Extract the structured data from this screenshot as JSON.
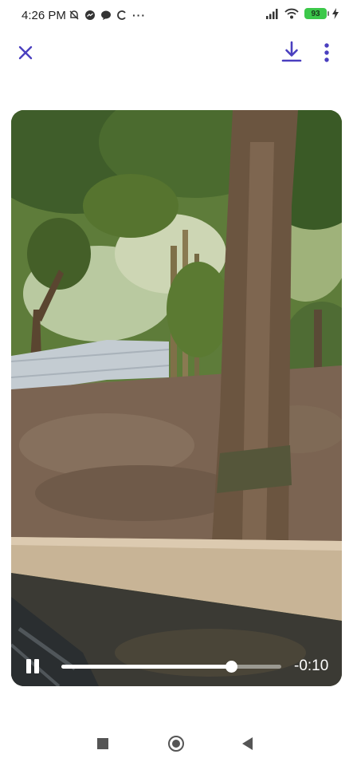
{
  "status_bar": {
    "time": "4:26 PM",
    "more_dots": "···",
    "battery_level": "93",
    "icons": [
      "alarm-off-icon",
      "messenger-icon",
      "chat-bubble-icon",
      "sync-icon",
      "signal-icon",
      "wifi-icon",
      "battery-icon",
      "charging-icon"
    ]
  },
  "app_bar": {
    "icons": [
      "close-icon",
      "download-icon",
      "more-vertical-icon"
    ],
    "accent_color": "#4a3fbf"
  },
  "video": {
    "playing": true,
    "progress": 0.77,
    "remaining_time": "-0:10"
  },
  "nav_bar": {
    "icons": [
      "recents-square-icon",
      "home-circle-icon",
      "back-triangle-icon"
    ]
  }
}
